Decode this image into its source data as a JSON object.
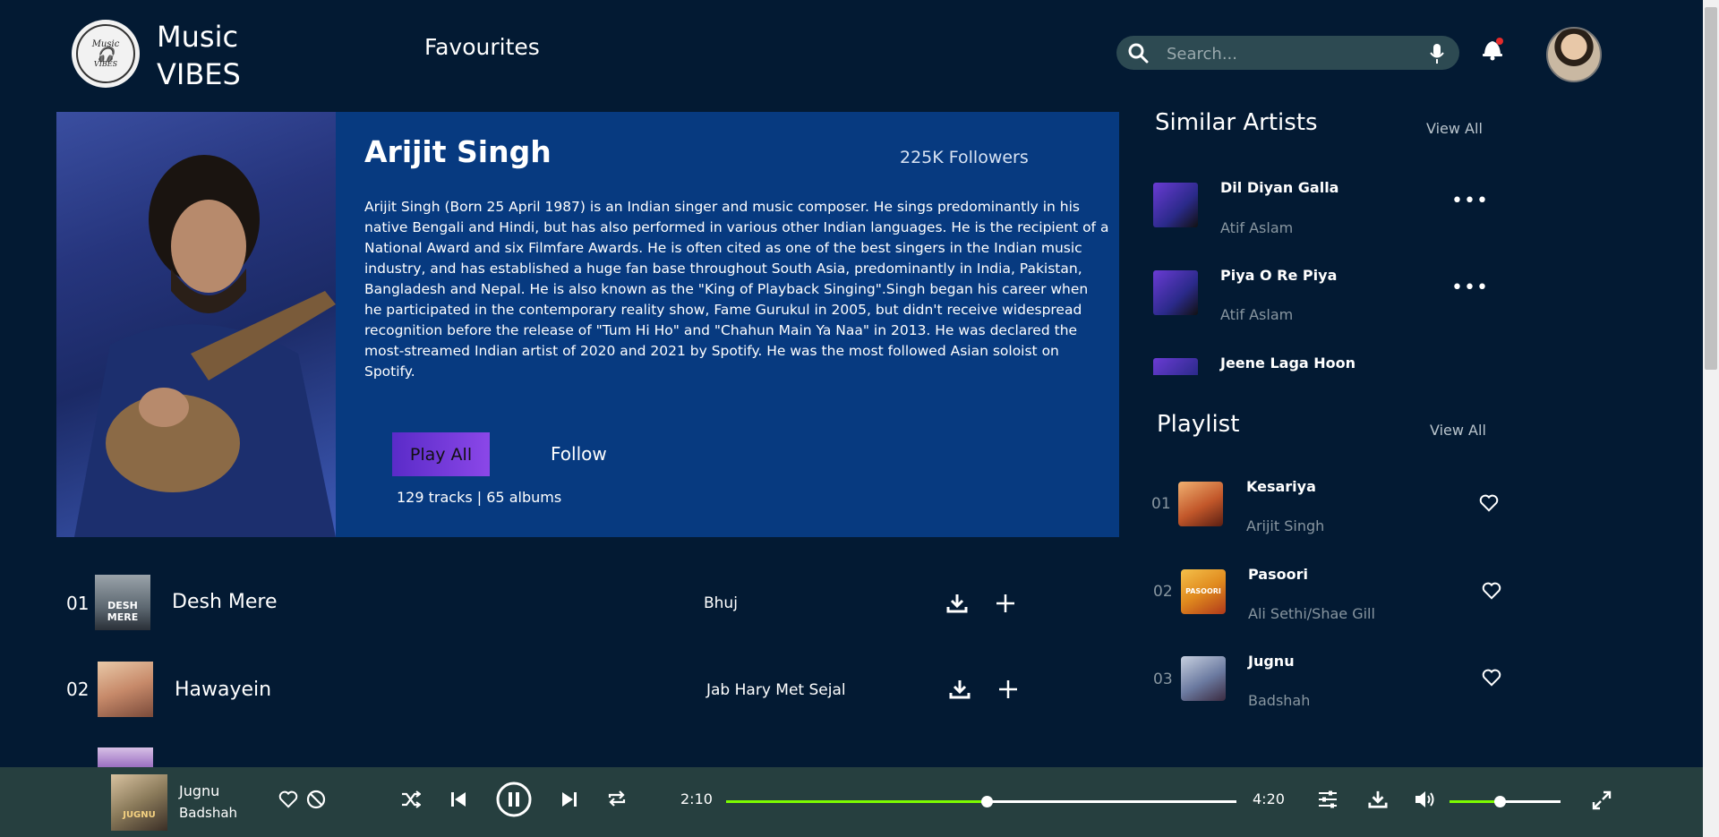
{
  "header": {
    "logo_top": "Music",
    "logo_bottom": "VIBES",
    "brand_line1": "Music",
    "brand_line2": "VIBES",
    "nav_favourites": "Favourites",
    "search_placeholder": "Search...",
    "icons": [
      "search-icon",
      "microphone-icon",
      "bell-icon",
      "avatar"
    ]
  },
  "artist": {
    "name": "Arijit Singh",
    "followers": "225K Followers",
    "bio": "Arijit Singh (Born 25 April 1987) is an Indian singer and music composer. He sings predominantly in his native Bengali and Hindi, but has also performed in various other Indian languages. He is the recipient of a National Award and six Filmfare Awards. He is often cited as one of the best singers in the Indian music industry, and has established a huge fan base throughout South Asia, predominantly in India, Pakistan, Bangladesh and Nepal. He is also known as the \"King of Playback Singing\".Singh began his career when he participated in the contemporary reality show, Fame Gurukul in 2005, but didn't receive widespread recognition before the release of \"Tum Hi Ho\" and \"Chahun Main Ya Naa\" in 2013. He was declared the most-streamed Indian artist of 2020 and 2021 by Spotify. He was the most followed Asian soloist on Spotify.",
    "play_all": "Play All",
    "follow": "Follow",
    "tracks_meta": "129 tracks | 65 albums"
  },
  "songs": [
    {
      "num": "01",
      "title": "Desh Mere",
      "album": "Bhuj",
      "thumb_text": "DESH MERE"
    },
    {
      "num": "02",
      "title": "Hawayein",
      "album": "Jab Hary Met Sejal",
      "thumb_text": ""
    }
  ],
  "similar": {
    "title": "Similar Artists",
    "view_all": "View All",
    "items": [
      {
        "title": "Dil Diyan Galla",
        "artist": "Atif Aslam"
      },
      {
        "title": "Piya O Re Piya",
        "artist": "Atif Aslam"
      },
      {
        "title": "Jeene Laga Hoon",
        "artist": ""
      }
    ]
  },
  "playlist": {
    "title": "Playlist",
    "view_all": "View All",
    "items": [
      {
        "num": "01",
        "title": "Kesariya",
        "artist": "Arijit Singh",
        "color": "#c2572a"
      },
      {
        "num": "02",
        "title": "Pasoori",
        "artist": "Ali Sethi/Shae Gill",
        "color": "#e08a1e",
        "thumb_text": "PASOORI"
      },
      {
        "num": "03",
        "title": "Jugnu",
        "artist": "Badshah",
        "color": "#6b7aa0"
      }
    ]
  },
  "player": {
    "title": "Jugnu",
    "artist": "Badshah",
    "thumb_text": "JUGNU",
    "elapsed": "2:10",
    "duration": "4:20",
    "progress_fraction": 0.51,
    "volume_fraction": 0.45,
    "accent": "#7cfc00"
  },
  "colors": {
    "background": "#031a33",
    "hero_panel": "#073a80",
    "player_bar": "#263f3f",
    "play_all_gradient": [
      "#5a2bc8",
      "#8b47e8"
    ]
  }
}
